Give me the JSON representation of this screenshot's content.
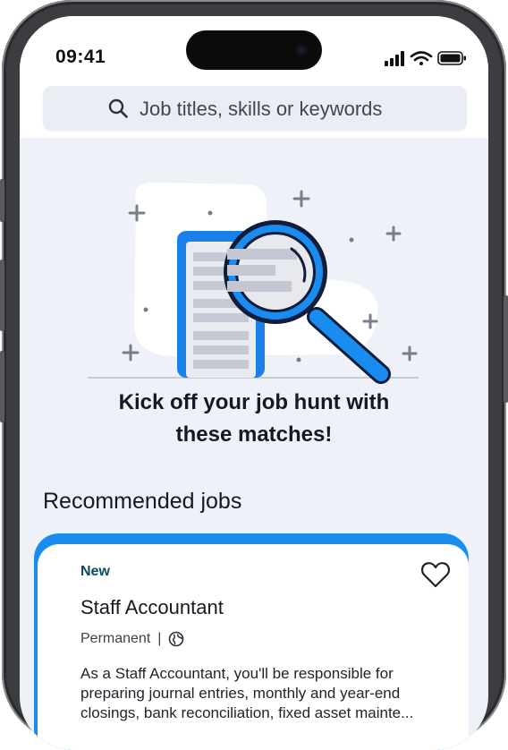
{
  "status_bar": {
    "time": "09:41"
  },
  "search": {
    "placeholder": "Job titles, skills or keywords"
  },
  "hero": {
    "headline_line1": "Kick off your job hunt with",
    "headline_line2": "these matches!"
  },
  "section": {
    "title": "Recommended jobs"
  },
  "job_card": {
    "badge": "New",
    "title": "Staff Accountant",
    "employment_type": "Permanent",
    "separator": "|",
    "location_icon": "globe-icon",
    "description": "As a Staff Accountant, you'll be responsible for preparing journal entries, monthly and year-end closings, bank reconciliation, fixed asset mainte..."
  },
  "colors": {
    "accent": "#1a8cf0",
    "background": "#eef2f8",
    "badge_text": "#0c4a5a"
  }
}
